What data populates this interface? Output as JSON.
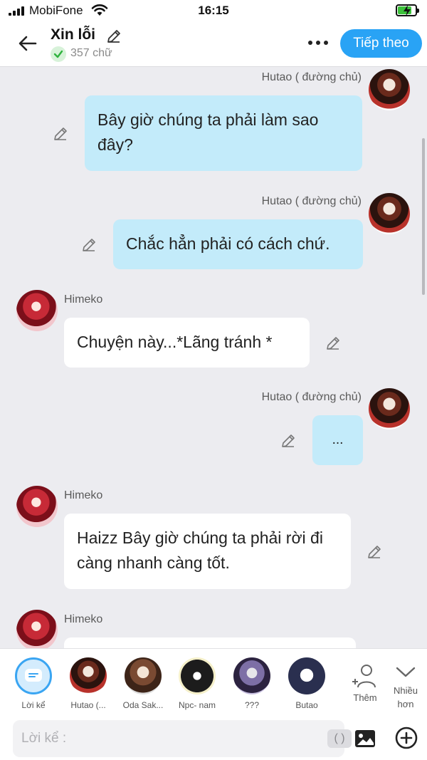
{
  "status_bar": {
    "carrier": "MobiFone",
    "time": "16:15",
    "battery_level": 0.8
  },
  "header": {
    "title": "Xin lỗi",
    "word_count": "357 chữ",
    "next_label": "Tiếp theo"
  },
  "messages": [
    {
      "speaker": "Hutao ( đường chủ)",
      "side": "right",
      "text": "Bây giờ chúng ta phải làm sao đây?"
    },
    {
      "speaker": "Hutao ( đường chủ)",
      "side": "right",
      "text": "Chắc hẳn phải có cách chứ."
    },
    {
      "speaker": "Himeko",
      "side": "left",
      "text": "Chuyện này...*Lãng tránh *"
    },
    {
      "speaker": "Hutao ( đường chủ)",
      "side": "right",
      "text": "..."
    },
    {
      "speaker": "Himeko",
      "side": "left",
      "text": "Haizz Bây giờ chúng ta phải rời đi càng nhanh càng tốt."
    },
    {
      "speaker": "Himeko",
      "side": "left",
      "text": ""
    }
  ],
  "characters": [
    {
      "label": "Lời kể"
    },
    {
      "label": "Hutao (..."
    },
    {
      "label": "Oda Sak..."
    },
    {
      "label": "Npc- nam"
    },
    {
      "label": "???"
    },
    {
      "label": "Butao"
    }
  ],
  "add_character_label": "Thêm",
  "more_label": "Nhiều hơn",
  "input": {
    "placeholder": "Lời kể :",
    "paren": "( )"
  },
  "colors": {
    "accent": "#29a3f5",
    "my_bubble": "#c3ebfa",
    "background": "#ececf0"
  },
  "icons": [
    "back-arrow-icon",
    "pencil-icon",
    "check-icon",
    "more-dots-icon",
    "person-add-icon",
    "chevron-down-icon",
    "image-icon",
    "plus-circle-icon"
  ]
}
